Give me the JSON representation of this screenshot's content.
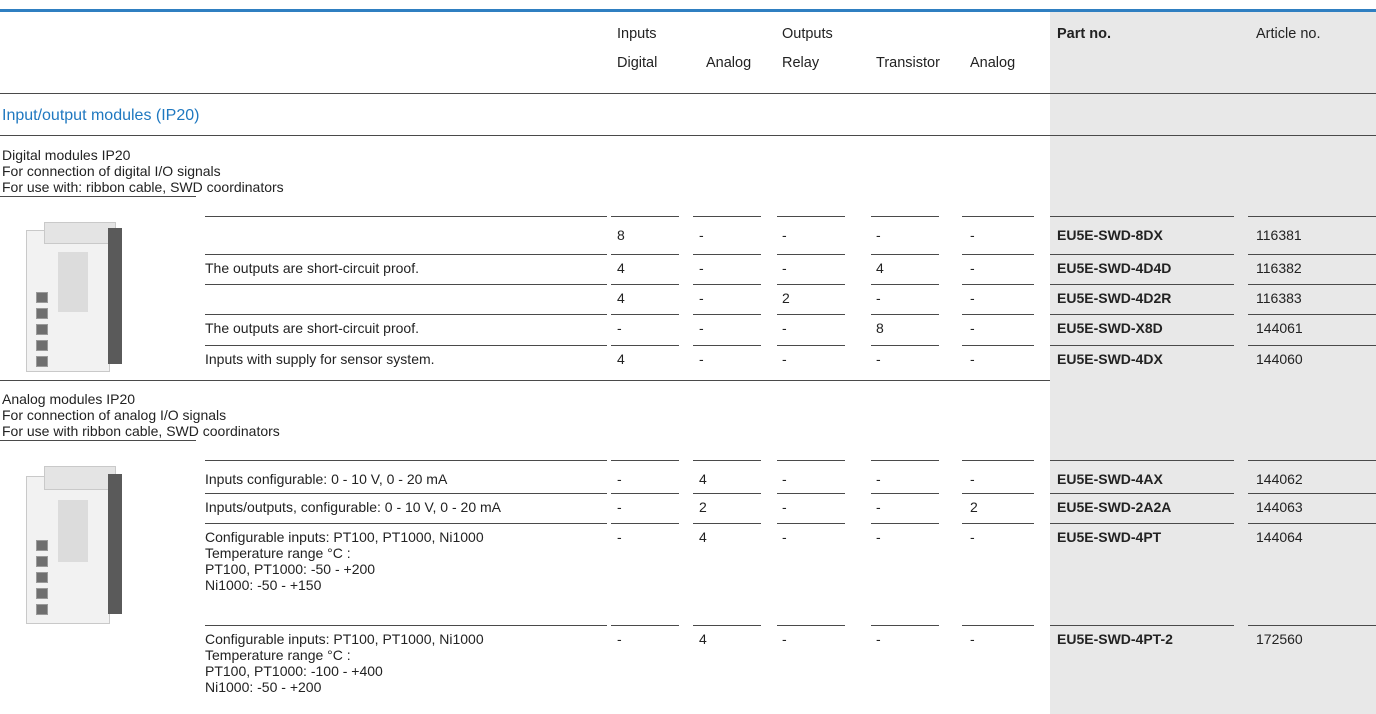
{
  "header": {
    "inputs": "Inputs",
    "digital": "Digital",
    "analog_in": "Analog",
    "outputs": "Outputs",
    "relay": "Relay",
    "transistor": "Transistor",
    "analog_out": "Analog",
    "part_no": "Part no.",
    "article_no": "Article no."
  },
  "section_title": "Input/output modules (IP20)",
  "group1": {
    "line1": "Digital modules IP20",
    "line2": "For connection of digital I/O signals",
    "line3": "For use with: ribbon cable, SWD coordinators"
  },
  "group1_rows": [
    {
      "desc": "",
      "din": "8",
      "ain": "-",
      "relay": "-",
      "trans": "-",
      "aout": "-",
      "part": "EU5E-SWD-8DX",
      "article": "116381"
    },
    {
      "desc": "The outputs are short-circuit proof.",
      "din": "4",
      "ain": "-",
      "relay": "-",
      "trans": "4",
      "aout": "-",
      "part": "EU5E-SWD-4D4D",
      "article": "116382"
    },
    {
      "desc": "",
      "din": "4",
      "ain": "-",
      "relay": "2",
      "trans": "-",
      "aout": "-",
      "part": "EU5E-SWD-4D2R",
      "article": "116383"
    },
    {
      "desc": "The outputs are short-circuit proof.",
      "din": "-",
      "ain": "-",
      "relay": "-",
      "trans": "8",
      "aout": "-",
      "part": "EU5E-SWD-X8D",
      "article": "144061"
    },
    {
      "desc": "Inputs with supply for sensor system.",
      "din": "4",
      "ain": "-",
      "relay": "-",
      "trans": "-",
      "aout": "-",
      "part": "EU5E-SWD-4DX",
      "article": "144060"
    }
  ],
  "group2": {
    "line1": "Analog modules IP20",
    "line2": "For connection of analog I/O signals",
    "line3": "For use with ribbon cable, SWD coordinators"
  },
  "group2_rows": [
    {
      "desc": "Inputs configurable: 0 - 10 V, 0 - 20 mA",
      "din": "-",
      "ain": "4",
      "relay": "-",
      "trans": "-",
      "aout": "-",
      "part": "EU5E-SWD-4AX",
      "article": "144062"
    },
    {
      "desc": "Inputs/outputs, configurable: 0 - 10 V, 0 - 20 mA",
      "din": "-",
      "ain": "2",
      "relay": "-",
      "trans": "-",
      "aout": "2",
      "part": "EU5E-SWD-2A2A",
      "article": "144063"
    },
    {
      "desc": "Configurable inputs: PT100, PT1000, Ni1000\nTemperature range °C :\nPT100, PT1000: -50 - +200\nNi1000: -50 - +150",
      "din": "-",
      "ain": "4",
      "relay": "-",
      "trans": "-",
      "aout": "-",
      "part": "EU5E-SWD-4PT",
      "article": "144064"
    },
    {
      "desc": "Configurable inputs: PT100, PT1000, Ni1000\nTemperature range °C :\nPT100, PT1000: -100 - +400\nNi1000: -50 - +200",
      "din": "-",
      "ain": "4",
      "relay": "-",
      "trans": "-",
      "aout": "-",
      "part": "EU5E-SWD-4PT-2",
      "article": "172560"
    }
  ]
}
